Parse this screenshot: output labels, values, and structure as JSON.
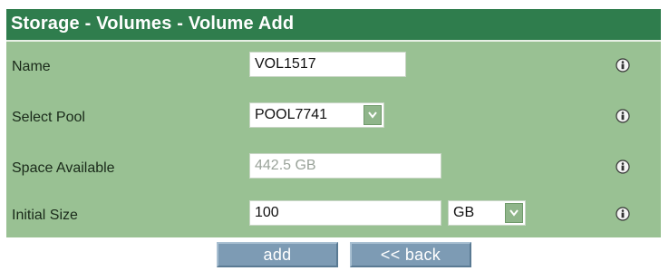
{
  "title": "Storage - Volumes - Volume Add",
  "form": {
    "name": {
      "label": "Name",
      "value": "VOL1517"
    },
    "pool": {
      "label": "Select Pool",
      "value": "POOL7741"
    },
    "space": {
      "label": "Space Available",
      "value": "442.5 GB"
    },
    "size": {
      "label": "Initial Size",
      "value": "100",
      "unit": "GB"
    }
  },
  "buttons": {
    "add": "add",
    "back": "<< back"
  },
  "colors": {
    "title_bar": "#2f7d4d",
    "panel": "#99c193",
    "button": "#7d9bb4"
  },
  "icons": [
    "info-icon",
    "chevron-down-icon"
  ]
}
